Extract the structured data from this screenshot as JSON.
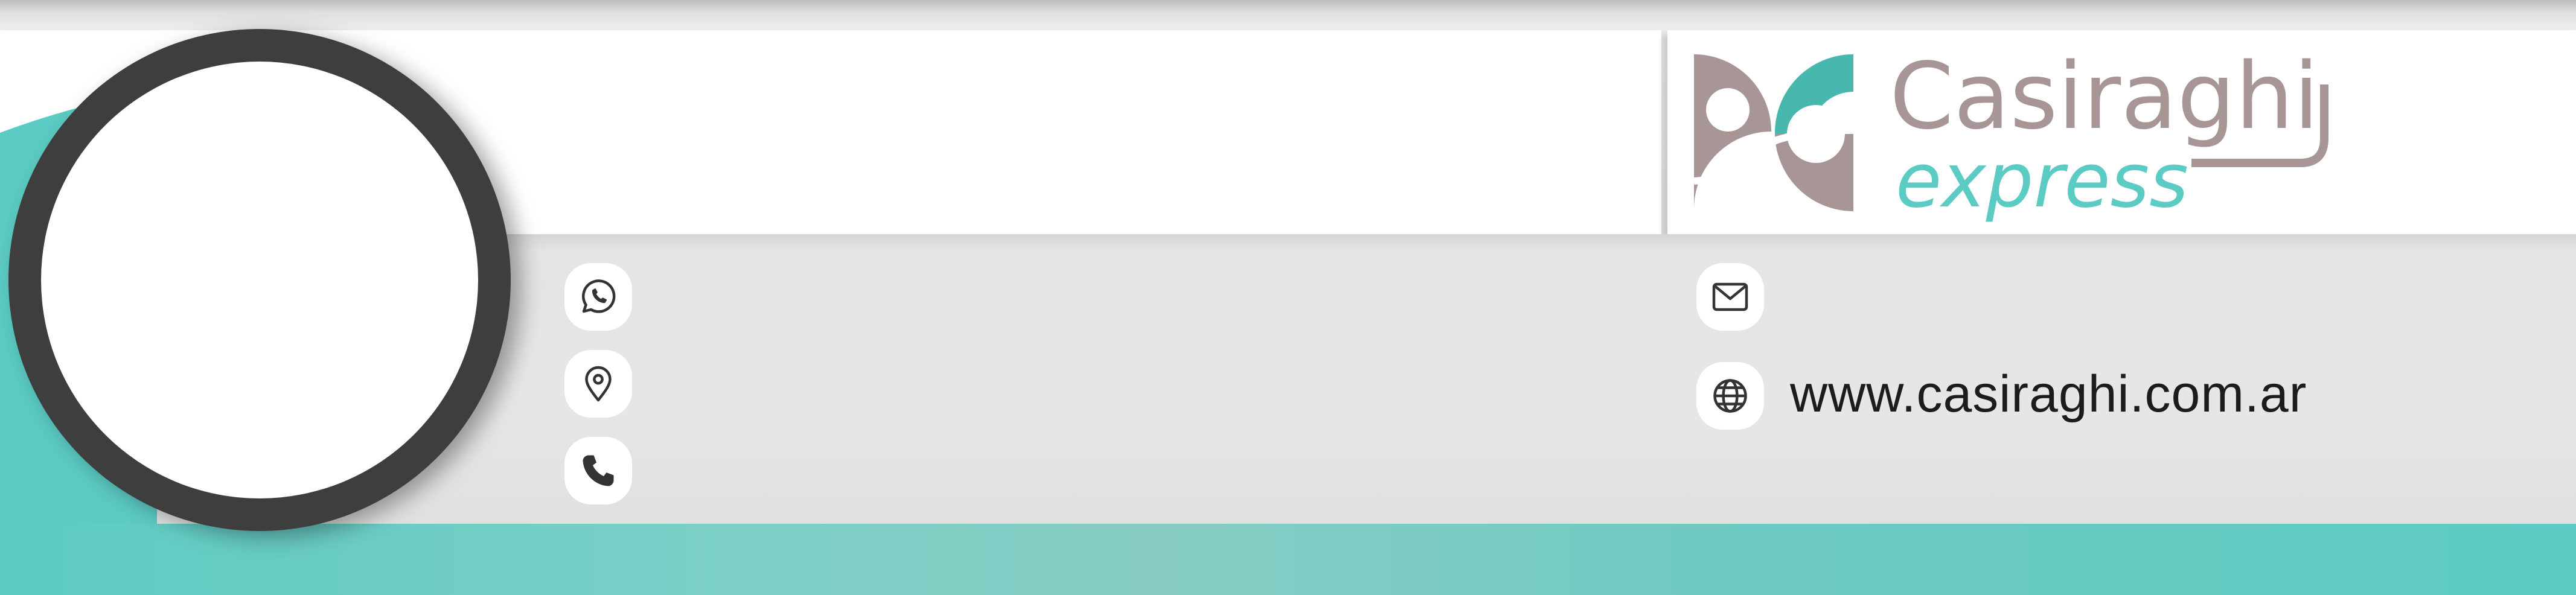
{
  "brand": {
    "name_line1": "Casiraghi",
    "name_line2": "express"
  },
  "contacts": {
    "whatsapp": {
      "icon": "whatsapp-icon",
      "value": ""
    },
    "location": {
      "icon": "location-pin-icon",
      "value": ""
    },
    "phone": {
      "icon": "phone-icon",
      "value": ""
    },
    "email": {
      "icon": "mail-icon",
      "value": ""
    },
    "website": {
      "icon": "globe-icon",
      "value": "www.casiraghi.com.ar"
    }
  },
  "colors": {
    "teal": "#5ccbc3",
    "taupe": "#a89596",
    "dark_ring": "#3e3e3f",
    "light_gray": "#e5e7e7"
  }
}
